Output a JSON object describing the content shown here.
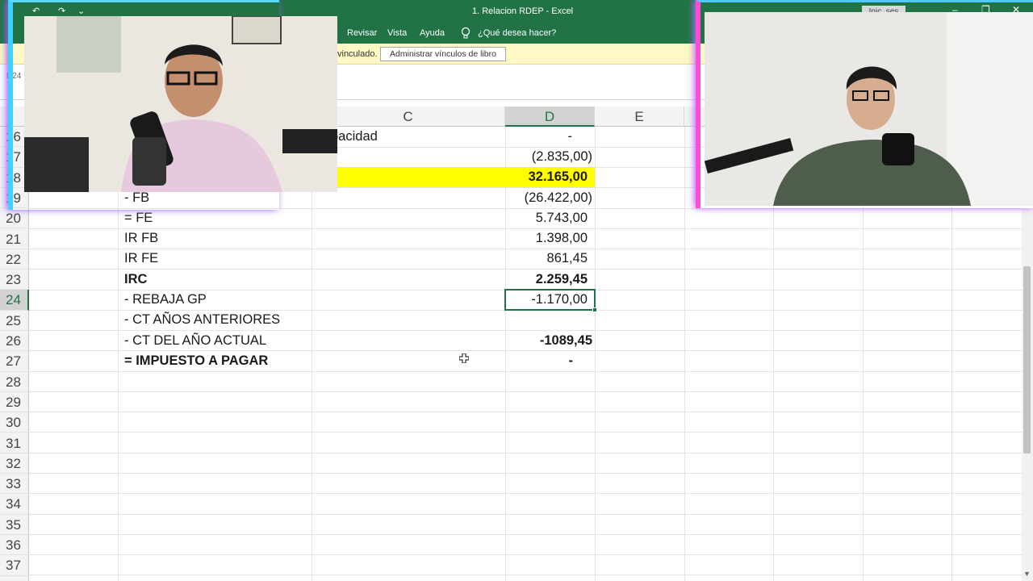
{
  "window": {
    "title": "1. Relacion RDEP  -  Excel",
    "signin_label": "Inic. ses",
    "minimize_glyph": "–",
    "restore_glyph": "❐",
    "close_glyph": "✕"
  },
  "quick_access": [
    "↶",
    "↷",
    "⌄"
  ],
  "ribbon_tabs": [
    "Revisar",
    "Vista",
    "Ayuda"
  ],
  "tell_me": "¿Qué desea hacer?",
  "message_bar": {
    "text": "vinculado.",
    "button_label": "Administrar vínculos de libro"
  },
  "name_box": "D24",
  "columns": [
    "C",
    "D",
    "E"
  ],
  "selected_column": "D",
  "rows": [
    "16",
    "17",
    "18",
    "19",
    "20",
    "21",
    "22",
    "23",
    "24",
    "25",
    "26",
    "27",
    "28",
    "29",
    "30",
    "31",
    "32",
    "33",
    "34",
    "35",
    "36",
    "37"
  ],
  "selected_row": "24",
  "cells": {
    "r16c": "pacidad",
    "r16d": "-",
    "r17d": "(2.835,00)",
    "r18d": "32.165,00",
    "r19b": "- FB",
    "r19d": "(26.422,00)",
    "r20b": "= FE",
    "r20d": "5.743,00",
    "r21b": "IR FB",
    "r21d": "1.398,00",
    "r22b": "IR FE",
    "r22d": "861,45",
    "r23b": "IRC",
    "r23d": "2.259,45",
    "r24b": "- REBAJA GP",
    "r24d": "-1.170,00",
    "r25b": "- CT AÑOS ANTERIORES",
    "r26b": "- CT DEL AÑO ACTUAL",
    "r26d": "-1089,45",
    "r27b": "= IMPUESTO A PAGAR",
    "r27d": "-"
  },
  "colors": {
    "excel_green": "#217346",
    "highlight_yellow": "#ffff00",
    "message_bar": "#fff8c4"
  }
}
